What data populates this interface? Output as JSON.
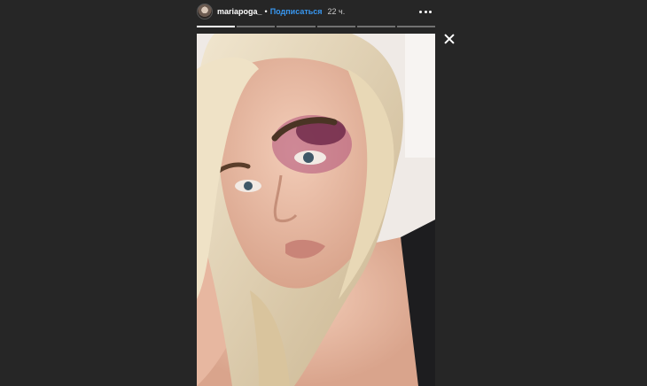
{
  "header": {
    "username": "mariapoga_",
    "separator": "•",
    "follow_label": "Подписаться",
    "time_ago": "22 ч."
  },
  "progress": {
    "segment_count": 6,
    "current_segment": 1,
    "done_color": "#ffffff",
    "pending_color": "rgba(255,255,255,0.35)"
  },
  "icons": {
    "more": "more-horizontal-icon",
    "close": "close-icon"
  },
  "colors": {
    "background": "#262626",
    "link": "#3897f0",
    "text": "#ffffff"
  }
}
